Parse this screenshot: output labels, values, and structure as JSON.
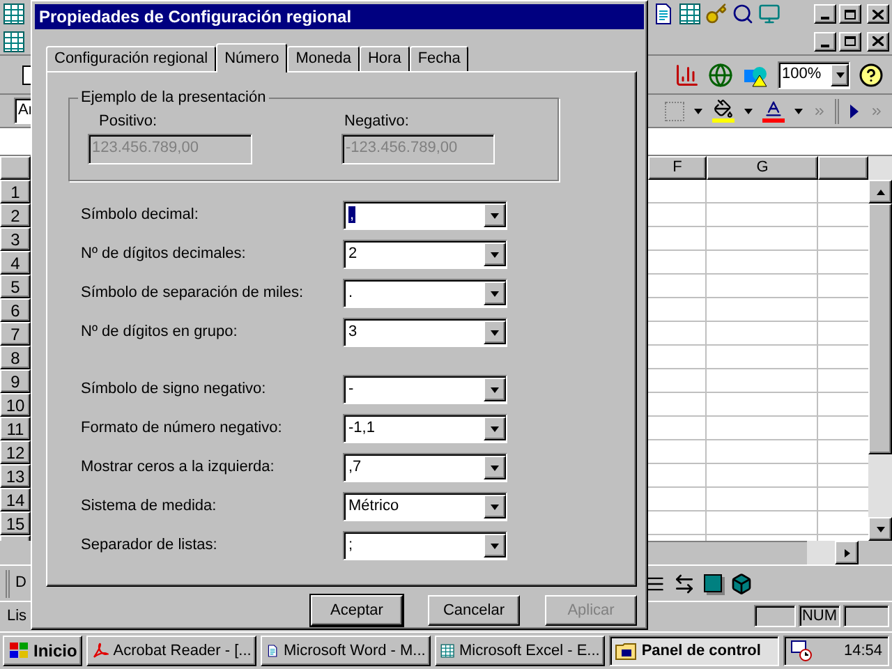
{
  "excel": {
    "font_field": "Ar",
    "zoom_field": "100%",
    "column_headers": [
      "F",
      "G"
    ],
    "row_headers": [
      "1",
      "2",
      "3",
      "4",
      "5",
      "6",
      "7",
      "8",
      "9",
      "10",
      "11",
      "12",
      "13",
      "14",
      "15"
    ],
    "drawing_toolbar_label": "D",
    "status_text": "Lis",
    "num_indicator": "NUM"
  },
  "dialog": {
    "title": "Propiedades de Configuración regional",
    "tabs": [
      {
        "label": "Configuración regional",
        "selected": false
      },
      {
        "label": "Número",
        "selected": true
      },
      {
        "label": "Moneda",
        "selected": false
      },
      {
        "label": "Hora",
        "selected": false
      },
      {
        "label": "Fecha",
        "selected": false
      }
    ],
    "sample": {
      "title": "Ejemplo de la presentación",
      "positive_label": "Positivo:",
      "positive_value": "123.456.789,00",
      "negative_label": "Negativo:",
      "negative_value": "-123.456.789,00"
    },
    "field_groups": [
      [
        {
          "label": "Símbolo decimal:",
          "value": ",",
          "focused": true
        },
        {
          "label": "Nº de dígitos decimales:",
          "value": "2",
          "focused": false
        },
        {
          "label": "Símbolo de separación de miles:",
          "value": ".",
          "focused": false
        },
        {
          "label": "Nº de dígitos en grupo:",
          "value": "3",
          "focused": false
        }
      ],
      [
        {
          "label": "Símbolo de signo negativo:",
          "value": "-",
          "focused": false
        },
        {
          "label": "Formato de número negativo:",
          "value": "-1,1",
          "focused": false
        },
        {
          "label": "Mostrar ceros a la izquierda:",
          "value": ",7",
          "focused": false
        },
        {
          "label": "Sistema de medida:",
          "value": "Métrico",
          "focused": false
        },
        {
          "label": "Separador de listas:",
          "value": ";",
          "focused": false
        }
      ]
    ],
    "buttons": [
      {
        "label": "Aceptar",
        "disabled": false
      },
      {
        "label": "Cancelar",
        "disabled": false
      },
      {
        "label": "Aplicar",
        "disabled": true
      }
    ]
  },
  "taskbar": {
    "start_label": "Inicio",
    "tasks": [
      {
        "kind": "acrobat",
        "label": "Acrobat Reader - [...",
        "selected": false
      },
      {
        "kind": "word",
        "label": "Microsoft Word - M...",
        "selected": false
      },
      {
        "kind": "excel",
        "label": "Microsoft Excel - E...",
        "selected": false
      },
      {
        "kind": "control_panel",
        "label": "Panel de control",
        "selected": true
      }
    ],
    "clock": "14:54"
  }
}
